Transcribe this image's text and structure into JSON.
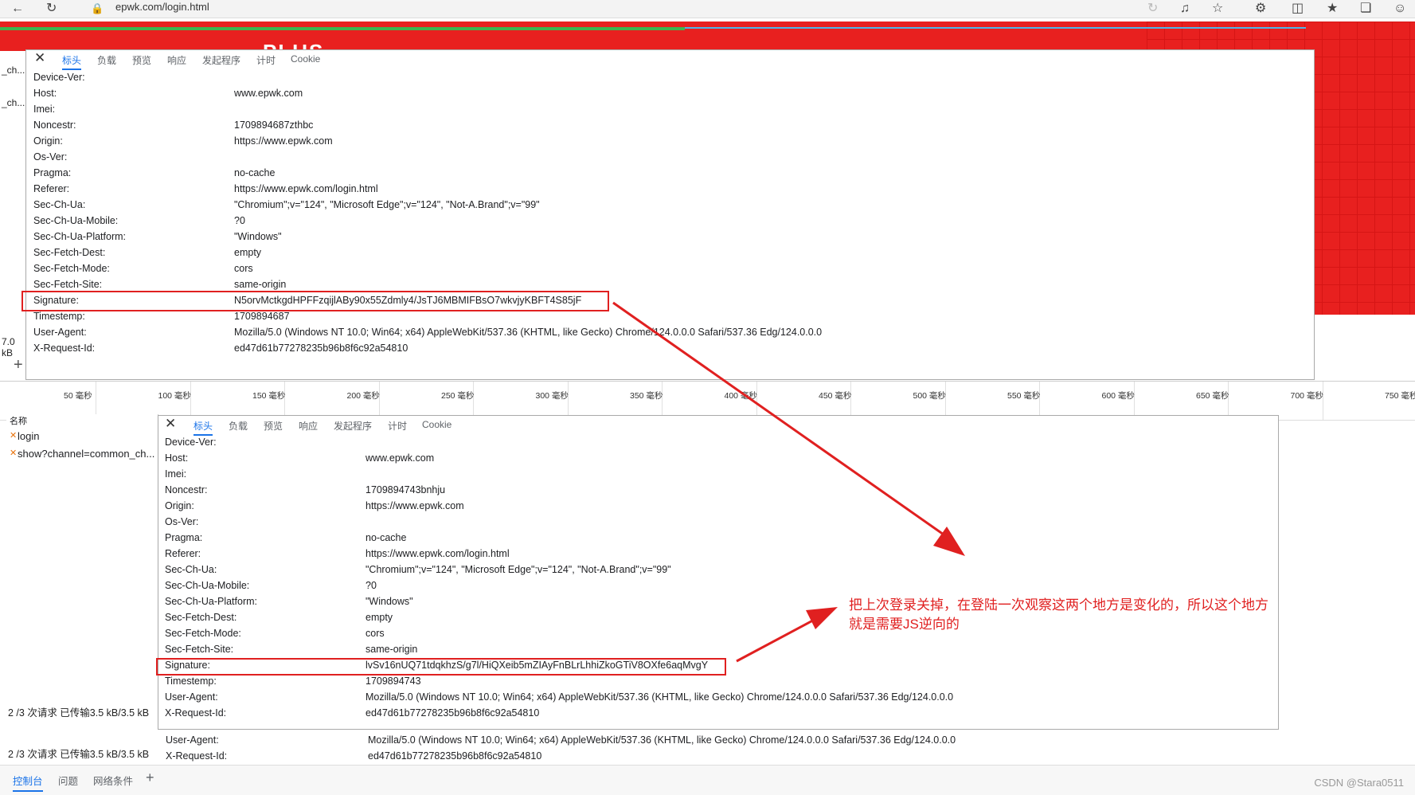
{
  "browser": {
    "url": "epwk.com/login.html"
  },
  "banner": {
    "text": "PLUS"
  },
  "left_cut": [
    "_ch...",
    "_ch...",
    "7.0 kB"
  ],
  "tabs": [
    "标头",
    "负载",
    "预览",
    "响应",
    "发起程序",
    "计时",
    "Cookie"
  ],
  "panel_top": {
    "headers": [
      {
        "k": "Device-Ver:",
        "v": ""
      },
      {
        "k": "Host:",
        "v": "www.epwk.com"
      },
      {
        "k": "Imei:",
        "v": ""
      },
      {
        "k": "Noncestr:",
        "v": "1709894687zthbc"
      },
      {
        "k": "Origin:",
        "v": "https://www.epwk.com"
      },
      {
        "k": "Os-Ver:",
        "v": ""
      },
      {
        "k": "Pragma:",
        "v": "no-cache"
      },
      {
        "k": "Referer:",
        "v": "https://www.epwk.com/login.html"
      },
      {
        "k": "Sec-Ch-Ua:",
        "v": "\"Chromium\";v=\"124\", \"Microsoft Edge\";v=\"124\", \"Not-A.Brand\";v=\"99\""
      },
      {
        "k": "Sec-Ch-Ua-Mobile:",
        "v": "?0"
      },
      {
        "k": "Sec-Ch-Ua-Platform:",
        "v": "\"Windows\""
      },
      {
        "k": "Sec-Fetch-Dest:",
        "v": "empty"
      },
      {
        "k": "Sec-Fetch-Mode:",
        "v": "cors"
      },
      {
        "k": "Sec-Fetch-Site:",
        "v": "same-origin"
      },
      {
        "k": "Signature:",
        "v": "N5orvMctkgdHPFFzqijlABy90x55Zdmly4/JsTJ6MBMIFBsO7wkvjyKBFT4S85jF"
      },
      {
        "k": "Timestemp:",
        "v": "1709894687"
      },
      {
        "k": "User-Agent:",
        "v": "Mozilla/5.0 (Windows NT 10.0; Win64; x64) AppleWebKit/537.36 (KHTML, like Gecko) Chrome/124.0.0.0 Safari/537.36 Edg/124.0.0.0"
      },
      {
        "k": "X-Request-Id:",
        "v": "ed47d61b77278235b96b8f6c92a54810"
      }
    ]
  },
  "timeline": {
    "ticks": [
      "50 毫秒",
      "100 毫秒",
      "150 毫秒",
      "200 毫秒",
      "250 毫秒",
      "300 毫秒",
      "350 毫秒",
      "400 毫秒",
      "450 毫秒",
      "500 毫秒",
      "550 毫秒",
      "600 毫秒",
      "650 毫秒",
      "700 毫秒",
      "750 毫秒"
    ]
  },
  "net_list": {
    "header": "名称",
    "items": [
      "login",
      "show?channel=common_ch..."
    ]
  },
  "panel_bottom": {
    "headers": [
      {
        "k": "Device-Ver:",
        "v": ""
      },
      {
        "k": "Host:",
        "v": "www.epwk.com"
      },
      {
        "k": "Imei:",
        "v": ""
      },
      {
        "k": "Noncestr:",
        "v": "1709894743bnhju"
      },
      {
        "k": "Origin:",
        "v": "https://www.epwk.com"
      },
      {
        "k": "Os-Ver:",
        "v": ""
      },
      {
        "k": "Pragma:",
        "v": "no-cache"
      },
      {
        "k": "Referer:",
        "v": "https://www.epwk.com/login.html"
      },
      {
        "k": "Sec-Ch-Ua:",
        "v": "\"Chromium\";v=\"124\", \"Microsoft Edge\";v=\"124\", \"Not-A.Brand\";v=\"99\""
      },
      {
        "k": "Sec-Ch-Ua-Mobile:",
        "v": "?0"
      },
      {
        "k": "Sec-Ch-Ua-Platform:",
        "v": "\"Windows\""
      },
      {
        "k": "Sec-Fetch-Dest:",
        "v": "empty"
      },
      {
        "k": "Sec-Fetch-Mode:",
        "v": "cors"
      },
      {
        "k": "Sec-Fetch-Site:",
        "v": "same-origin"
      },
      {
        "k": "Signature:",
        "v": "lvSv16nUQ71tdqkhzS/g7l/HiQXeib5mZIAyFnBLrLhhiZkoGTiV8OXfe6aqMvgY"
      },
      {
        "k": "Timestemp:",
        "v": "1709894743"
      },
      {
        "k": "User-Agent:",
        "v": "Mozilla/5.0 (Windows NT 10.0; Win64; x64) AppleWebKit/537.36 (KHTML, like Gecko) Chrome/124.0.0.0 Safari/537.36 Edg/124.0.0.0"
      },
      {
        "k": "X-Request-Id:",
        "v": "ed47d61b77278235b96b8f6c92a54810"
      }
    ]
  },
  "under_rows": [
    {
      "k": "User-Agent:",
      "v": "Mozilla/5.0 (Windows NT 10.0; Win64; x64) AppleWebKit/537.36 (KHTML, like Gecko) Chrome/124.0.0.0 Safari/537.36 Edg/124.0.0.0"
    },
    {
      "k": "X-Request-Id:",
      "v": "ed47d61b77278235b96b8f6c92a54810"
    }
  ],
  "status": {
    "line1": "2 /3 次请求  已传输3.5 kB/3.5 kB",
    "line2": "2 /3 次请求  已传输3.5 kB/3.5 kB"
  },
  "bottom_tabs": [
    "控制台",
    "问题",
    "网络条件"
  ],
  "annotation": "把上次登录关掉，在登陆一次观察这两个地方是变化的，所以这个地方就是需要JS逆向的",
  "watermark": "CSDN @Stara0511",
  "colors": {
    "banner_red": "#e8201f",
    "annotation_red": "#e02020",
    "active_tab": "#1a73e8"
  }
}
